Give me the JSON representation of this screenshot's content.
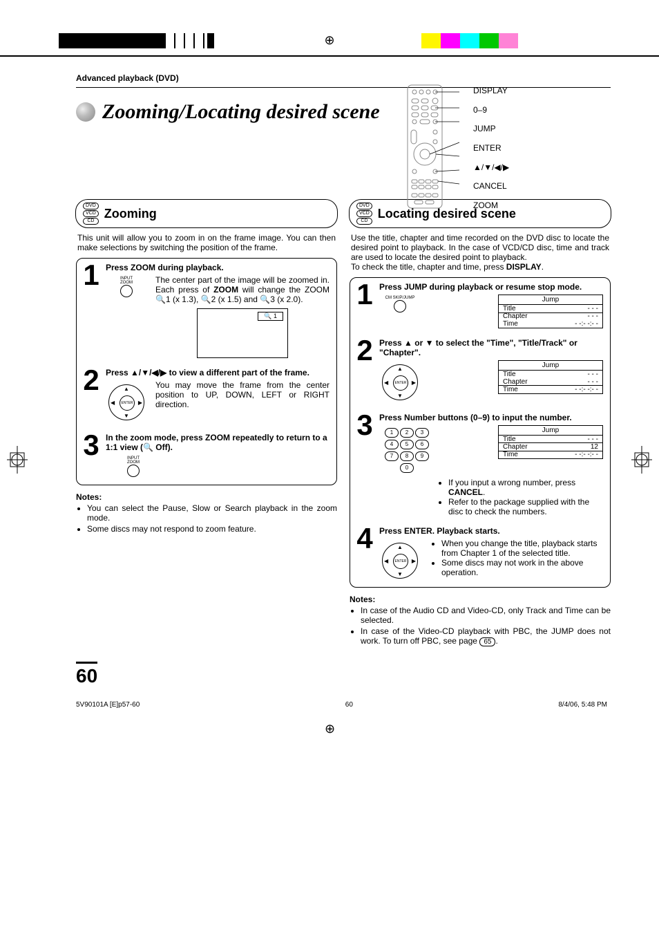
{
  "breadcrumb": "Advanced playback (DVD)",
  "title": "Zooming/Locating desired scene",
  "remote_labels": [
    "DISPLAY",
    "0–9",
    "JUMP",
    "ENTER",
    "▲/▼/◀/▶",
    "CANCEL",
    "ZOOM"
  ],
  "zooming": {
    "heading": "Zooming",
    "badges": [
      "DVD",
      "VCD",
      "CD"
    ],
    "intro": "This unit will allow you to zoom in on the frame image. You can then make selections by switching the position of the frame.",
    "steps": [
      {
        "num": "1",
        "title": "Press ZOOM during playback.",
        "icon_label": "INPUT\nZOOM",
        "text_pre": "The center part of the image will be zoomed in.\nEach press of ",
        "text_bold": "ZOOM",
        "text_post": " will change the ZOOM 🔍1 (x 1.3), 🔍2 (x 1.5) and 🔍3 (x 2.0).",
        "preview_q": "🔍 1"
      },
      {
        "num": "2",
        "title": "Press ▲/▼/◀/▶ to view a different part of the frame.",
        "text": "You may move the frame from the center position to UP, DOWN, LEFT or RIGHT direction."
      },
      {
        "num": "3",
        "title": "In the zoom mode, press ZOOM repeatedly to return to a 1:1 view (🔍 Off).",
        "icon_label": "INPUT\nZOOM"
      }
    ],
    "notes_head": "Notes:",
    "notes": [
      "You can select the Pause, Slow or Search playback in the zoom mode.",
      "Some discs may not respond to zoom feature."
    ]
  },
  "locating": {
    "heading": "Locating desired scene",
    "badges": [
      "DVD",
      "VCD",
      "CD"
    ],
    "intro": "Use the title, chapter and time recorded on the DVD disc to locate the desired point to playback. In the case of VCD/CD disc, time and track are used to locate the desired point to playback.",
    "check_pre": "To check the title, chapter and time, press ",
    "check_bold": "DISPLAY",
    "check_post": ".",
    "jump_header": "Jump",
    "jump_rows": [
      "Title",
      "Chapter",
      "Time"
    ],
    "jump_vals_blank": [
      "- - -",
      "- - -",
      "- -:- -:- -"
    ],
    "steps": [
      {
        "num": "1",
        "title": "Press JUMP during playback or resume stop mode.",
        "icon_label": "CM SKIP/JUMP",
        "highlight": "Title"
      },
      {
        "num": "2",
        "title": "Press ▲ or ▼ to select the \"Time\", \"Title/Track\" or \"Chapter\".",
        "highlight": "Time"
      },
      {
        "num": "3",
        "title": "Press Number buttons (0–9) to input the number.",
        "highlight": "Chapter",
        "chapter_val": "12",
        "bullets": [
          {
            "pre": "If you input a wrong number, press ",
            "bold": "CANCEL",
            "post": "."
          },
          {
            "pre": "Refer to the package supplied with the disc to check the numbers.",
            "bold": "",
            "post": ""
          }
        ]
      },
      {
        "num": "4",
        "title": "Press ENTER. Playback starts.",
        "bullets": [
          {
            "pre": "When you change the title, playback starts from Chapter 1 of the selected title.",
            "bold": "",
            "post": ""
          },
          {
            "pre": "Some discs may not work in the above operation.",
            "bold": "",
            "post": ""
          }
        ]
      }
    ],
    "notes_head": "Notes:",
    "notes": [
      "In case of the Audio CD and Video-CD, only Track and Time can be selected.",
      "In case of the Video-CD playback with PBC, the JUMP does not work. To turn off PBC, see page "
    ],
    "note2_pageref": "65"
  },
  "page_num": "60",
  "footer": {
    "left": "5V90101A [E]p57-60",
    "center": "60",
    "right": "8/4/06, 5:48 PM"
  }
}
